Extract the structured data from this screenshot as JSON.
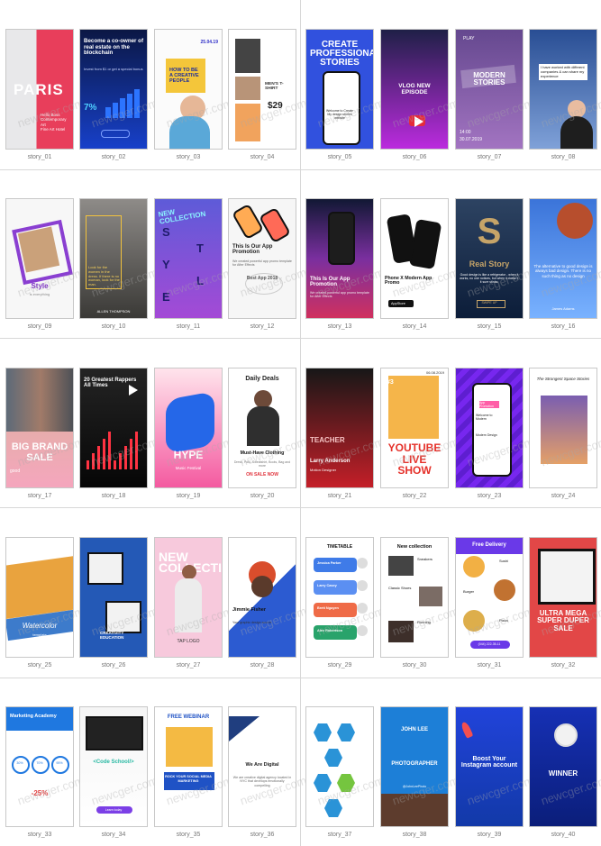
{
  "watermark_text": "newcger.com",
  "items": [
    {
      "label": "story_01",
      "title": "PARIS",
      "subtitle": "Hello Boss\nContemporary Art\nFine Art Hotel",
      "accent": "#d9364a",
      "theme": "pink-paris"
    },
    {
      "label": "story_02",
      "title": "Become a co-owner of real estate on the blockchain",
      "value": "7%",
      "subtitle": "Invest from $1 or get a special bonus",
      "accent": "#1b3cff",
      "theme": "blue-chart"
    },
    {
      "label": "story_03",
      "title": "HOW TO BE A CREATIVE PEOPLE",
      "date": "25.04.19",
      "accent": "#f3c61d",
      "theme": "man-creative"
    },
    {
      "label": "story_04",
      "title": "MEN'S T-SHIRT",
      "price": "$29",
      "accent": "#f0a36c",
      "theme": "tshirt"
    },
    {
      "label": "story_05",
      "title": "CREATE PROFESSIONAL STORIES",
      "subtitle": "Welcome to Create My design stories website",
      "accent": "#2b44d9",
      "theme": "create"
    },
    {
      "label": "story_06",
      "title": "VLOG NEW EPISODE",
      "accent": "#7f2fe0",
      "theme": "vlog"
    },
    {
      "label": "story_07",
      "title": "MODERN STORIES",
      "time": "14:00",
      "date": "30.07.2019",
      "accent": "#7a5ac5",
      "theme": "modern"
    },
    {
      "label": "story_08",
      "title": "I have worked with different companies & can share my experience",
      "accent": "#4f7ad7",
      "theme": "business"
    },
    {
      "label": "story_09",
      "title": "Style",
      "subtitle": "is everything",
      "accent": "#8a2fd2",
      "theme": "style"
    },
    {
      "label": "story_10",
      "title": "Look for the women in the dress. If there is no woman, look for the man.",
      "subtitle": "ALLEN THOMPSON",
      "accent": "#f2c23d",
      "theme": "quote"
    },
    {
      "label": "story_11",
      "title": "NEW COLLECTION",
      "letters": [
        "S",
        "T",
        "Y",
        "L",
        "E"
      ],
      "accent": "#5f47d8",
      "theme": "collection"
    },
    {
      "label": "story_12",
      "title": "This Is Our App Promotion",
      "subtitle": "We created powerful app promo template for After Effects",
      "badge": "Best App 2018",
      "accent": "#ffffff",
      "theme": "app-white"
    },
    {
      "label": "story_13",
      "title": "This Is Our App Promotion",
      "subtitle": "We created powerful app promo template for After Effects",
      "accent": "#e42a6b",
      "theme": "app-dark"
    },
    {
      "label": "story_14",
      "title": "Phone X Modern App Promo",
      "subtitle": "AppStore",
      "accent": "#111111",
      "theme": "phone-x"
    },
    {
      "label": "story_15",
      "title": "Real Story",
      "subtitle": "Good design is like a refrigerator - when it works, no one notices, but when it doesn't, it sure stinks.",
      "letter": "S",
      "button": "SWIPE UP",
      "accent": "#c5a266",
      "theme": "real-story"
    },
    {
      "label": "story_16",
      "title": "The alternative to good design is always bad design. There is no such thing as no design",
      "subtitle": "James Adams",
      "accent": "#4a8df0",
      "theme": "quote-blue"
    },
    {
      "label": "story_17",
      "title": "BIG BRAND SALE",
      "subtitle": "good",
      "accent": "#f19bb3",
      "theme": "sale"
    },
    {
      "label": "story_18",
      "title": "20 Greatest Rappers All Times",
      "accent": "#ff2d3d",
      "theme": "rappers"
    },
    {
      "label": "story_19",
      "title": "HYPE",
      "subtitle": "Music Festival",
      "accent": "#ff4d8d",
      "theme": "hype"
    },
    {
      "label": "story_20",
      "title": "Daily Deals",
      "headline": "Must-Have Clothing",
      "subtitle": "Dress, Polo, Sweatshirt, Boots, Bag and more",
      "cta": "ON SALE NOW",
      "accent": "#d7343a",
      "theme": "deals"
    },
    {
      "label": "story_21",
      "title": "TEACHER",
      "name": "Larry Anderson",
      "subtitle": "Motion Designer",
      "accent": "#d73136",
      "theme": "teacher"
    },
    {
      "label": "story_22",
      "title": "YOUTUBE LIVE SHOW",
      "date": "06.08.2019",
      "number": "#3",
      "accent": "#f23d30",
      "theme": "live"
    },
    {
      "label": "story_23",
      "title": "App Promotion",
      "subtitle": "Welcome to Modern",
      "sub2": "Modern Design",
      "accent": "#6a21e0",
      "theme": "purple-app"
    },
    {
      "label": "story_24",
      "title": "The Strongest Space Stories",
      "accent": "#b70f36",
      "theme": "space"
    },
    {
      "label": "story_25",
      "title": "Watercolor",
      "subtitle": "template",
      "accent": "#3b72c8",
      "theme": "watercolor"
    },
    {
      "label": "story_26",
      "title": "CREATIVITY EDUCATION",
      "accent": "#2f5da8",
      "theme": "education"
    },
    {
      "label": "story_27",
      "title": "NEW COLLECTION",
      "subtitle": "TAP LOGO",
      "accent": "#f180a8",
      "theme": "new-collection"
    },
    {
      "label": "story_28",
      "title": "Jimmie Fisher",
      "subtitle": "Your graphic design source",
      "accent": "#f07c2f",
      "theme": "jimmie"
    },
    {
      "label": "story_29",
      "title": "TIMETABLE",
      "names": [
        "Jessica Parker",
        "Larry Casey",
        "Brett Nguyen",
        "Alex Robertson"
      ],
      "accent": "#3a7dea",
      "theme": "timetable"
    },
    {
      "label": "story_30",
      "title": "New collection",
      "subtitle": "Sneakers",
      "sub2": "Classic Shoes",
      "sub3": "Running",
      "accent": "#111111",
      "theme": "shoes"
    },
    {
      "label": "story_31",
      "title": "Free Delivery",
      "subtitle": "Sushi",
      "sub2": "Burger",
      "sub3": "Pizza",
      "phone": "(044) 222-35-11",
      "accent": "#6c39e8",
      "theme": "delivery"
    },
    {
      "label": "story_32",
      "title": "ULTRA MEGA SUPER DUPER SALE",
      "accent": "#d62c37",
      "theme": "mega-sale"
    },
    {
      "label": "story_33",
      "title": "Marketing Academy",
      "percents": [
        "30%",
        "70%",
        "95%"
      ],
      "discount": "-25%",
      "accent": "#1f78e0",
      "theme": "academy"
    },
    {
      "label": "story_34",
      "title": "<Code School/>",
      "subtitle": "Learn today",
      "accent": "#4ee1c4",
      "theme": "code"
    },
    {
      "label": "story_35",
      "title": "FREE WEBINAR",
      "headline": "ROCK YOUR SOCIAL MEDIA MARKETING",
      "accent": "#1f52c5",
      "theme": "webinar"
    },
    {
      "label": "story_36",
      "title": "We Are Digital",
      "subtitle": "We are creative digital agency located in NYC that develops emotionally compelling",
      "accent": "#1a2e59",
      "theme": "digital"
    },
    {
      "label": "story_37",
      "title": "",
      "accent": "#2a93d7",
      "theme": "hexagons"
    },
    {
      "label": "story_38",
      "title": "JOHN LEE",
      "subtitle": "PHOTOGRAPHER",
      "handle": "@JohnLeePhoto",
      "accent": "#1a79d2",
      "theme": "photographer"
    },
    {
      "label": "story_39",
      "title": "Boost Your Instagram account",
      "accent": "#1544c9",
      "theme": "boost"
    },
    {
      "label": "story_40",
      "title": "WINNER",
      "accent": "#0c2aa8",
      "theme": "winner"
    }
  ]
}
